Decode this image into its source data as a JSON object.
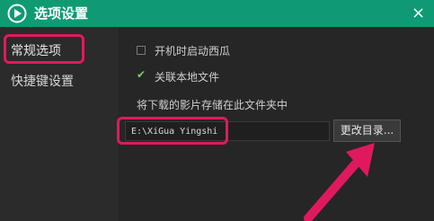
{
  "window": {
    "title": "选项设置",
    "close_glyph": "×",
    "accent_color": "#0f9a74"
  },
  "sidebar": {
    "items": [
      {
        "label": "常规选项",
        "selected": true
      },
      {
        "label": "快捷键设置",
        "selected": false
      }
    ]
  },
  "options": {
    "startup": {
      "label": "开机时启动西瓜",
      "checked": false
    },
    "associate": {
      "label": "关联本地文件",
      "checked": true
    }
  },
  "save_location": {
    "label": "将下载的影片存储在此文件夹中",
    "path_value": "E:\\XiGua Yingshi",
    "change_button_label": "更改目录..."
  },
  "annotations": {
    "highlight_color": "#e0195f",
    "arrow_icon": "pink-arrow-icon"
  },
  "icons": {
    "logo": "play-logo-icon",
    "close": "close-icon",
    "check": "check-icon"
  }
}
